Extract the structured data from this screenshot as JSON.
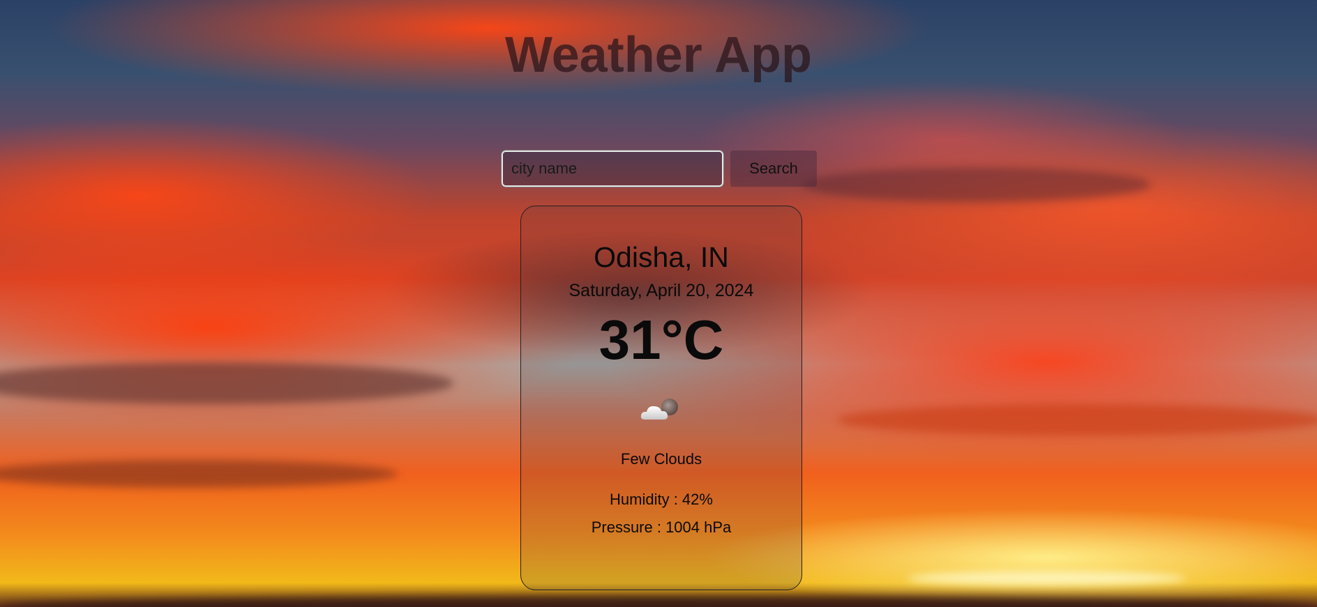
{
  "app": {
    "title": "Weather App"
  },
  "search": {
    "placeholder": "city name",
    "value": "",
    "button_label": "Search"
  },
  "weather": {
    "location": "Odisha, IN",
    "date": "Saturday, April 20, 2024",
    "temperature": "31°C",
    "icon": "few-clouds-night-icon",
    "description": "Few Clouds",
    "humidity": "Humidity : 42%",
    "pressure": "Pressure : 1004 hPa"
  },
  "colors": {
    "sky_top": "#2c4166",
    "sky_red": "#d2452a",
    "horizon_orange": "#f38a1c",
    "horizon_yellow": "#f2b91a"
  }
}
